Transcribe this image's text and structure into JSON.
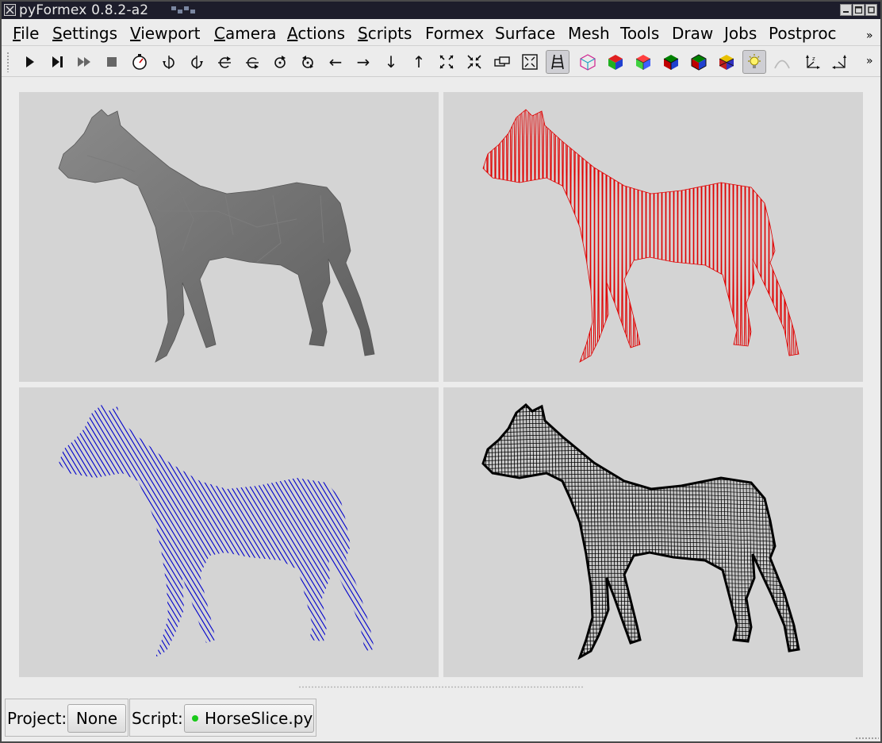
{
  "window": {
    "title": "pyFormex 0.8.2-a2"
  },
  "menubar": {
    "items": [
      {
        "label": "File",
        "accel": "F",
        "rest": "ile"
      },
      {
        "label": "Settings",
        "accel": "S",
        "rest": "ettings"
      },
      {
        "label": "Viewport",
        "accel": "V",
        "rest": "iewport"
      },
      {
        "label": "Camera",
        "accel": "C",
        "rest": "amera"
      },
      {
        "label": "Actions",
        "accel": "A",
        "rest": "ctions"
      },
      {
        "label": "Scripts",
        "accel": "S",
        "rest": "cripts"
      },
      {
        "label": "Formex",
        "accel": "",
        "rest": "Formex"
      },
      {
        "label": "Surface",
        "accel": "",
        "rest": "Surface"
      },
      {
        "label": "Mesh",
        "accel": "",
        "rest": "Mesh"
      },
      {
        "label": "Tools",
        "accel": "",
        "rest": "Tools"
      },
      {
        "label": "Draw",
        "accel": "",
        "rest": "Draw"
      },
      {
        "label": "Jobs",
        "accel": "",
        "rest": "Jobs"
      },
      {
        "label": "Postproc",
        "accel": "",
        "rest": "Postproc"
      }
    ],
    "overflow": "»"
  },
  "toolbar": {
    "overflow": "»",
    "buttons": [
      {
        "icon": "play-icon"
      },
      {
        "icon": "step-icon"
      },
      {
        "icon": "continue-icon"
      },
      {
        "icon": "stop-icon"
      },
      {
        "icon": "timer-icon"
      },
      {
        "icon": "rotate-left-icon"
      },
      {
        "icon": "rotate-right-icon"
      },
      {
        "icon": "rotate-up-icon"
      },
      {
        "icon": "rotate-down-icon"
      },
      {
        "icon": "twist-left-icon"
      },
      {
        "icon": "twist-right-icon"
      },
      {
        "icon": "pan-left-icon",
        "glyph": "←"
      },
      {
        "icon": "pan-right-icon",
        "glyph": "→"
      },
      {
        "icon": "pan-down-icon",
        "glyph": "↓"
      },
      {
        "icon": "pan-up-icon",
        "glyph": "↑"
      },
      {
        "icon": "zoom-in-icon"
      },
      {
        "icon": "zoom-out-icon"
      },
      {
        "icon": "view-box-icon"
      },
      {
        "icon": "zoom-all-icon"
      },
      {
        "icon": "perspective-icon",
        "active": true
      },
      {
        "icon": "wireframe-cube-icon"
      },
      {
        "icon": "flat-cube-icon"
      },
      {
        "icon": "smooth-cube-icon"
      },
      {
        "icon": "smoothwire-cube-icon"
      },
      {
        "icon": "flatwire-cube-icon"
      },
      {
        "icon": "transparent-cube-icon"
      },
      {
        "icon": "lights-icon",
        "active": true
      },
      {
        "icon": "normals-icon"
      },
      {
        "icon": "axes-icon"
      },
      {
        "icon": "axes-alt-icon"
      }
    ]
  },
  "viewports": [
    {
      "name": "viewport-top-left",
      "style": "solid",
      "color": "#6e6e6e"
    },
    {
      "name": "viewport-top-right",
      "style": "vertical-slices",
      "color": "#e00000"
    },
    {
      "name": "viewport-bottom-left",
      "style": "diagonal-slices",
      "color": "#0000cc"
    },
    {
      "name": "viewport-bottom-right",
      "style": "wireframe",
      "color": "#000000"
    }
  ],
  "statusbar": {
    "project_label": "Project:",
    "project_value": "None",
    "script_label": "Script:",
    "script_value": "HorseSlice.py",
    "script_status_color": "#19c919"
  }
}
